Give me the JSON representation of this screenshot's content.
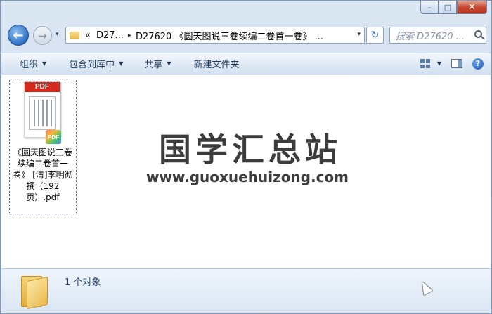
{
  "window": {
    "minimize_glyph": "–",
    "maximize_glyph": "□",
    "close_glyph": "✕"
  },
  "nav": {
    "back_glyph": "←",
    "forward_glyph": "→",
    "dropdown_glyph": "▾"
  },
  "address": {
    "overflow": "«",
    "crumbs": [
      "D27...",
      "D27620 《圆天图说三卷续编二卷首一卷》 ..."
    ],
    "separator": "▸",
    "dropdown_glyph": "▾"
  },
  "refresh_glyph": "↻",
  "search": {
    "placeholder": "搜索 D27620 ..."
  },
  "toolbar": {
    "organize": "组织",
    "include_in_library": "包含到库中",
    "share": "共享",
    "new_folder": "新建文件夹",
    "arrow": "▼",
    "help_glyph": "?"
  },
  "files": [
    {
      "thumb_label": "PDF",
      "badge_label": "PDF",
      "name": "《圆天图说三卷续编二卷首一卷》 [清]李明彻撰（192页）.pdf",
      "selected": true
    }
  ],
  "watermark": {
    "title": "国学汇总站",
    "url": "www.guoxuehuizong.com"
  },
  "details": {
    "object_count": "1 个对象"
  },
  "colors": {
    "accent": "#1e395b",
    "pdf_red": "#d42a1e",
    "close_red": "#c74a33"
  }
}
